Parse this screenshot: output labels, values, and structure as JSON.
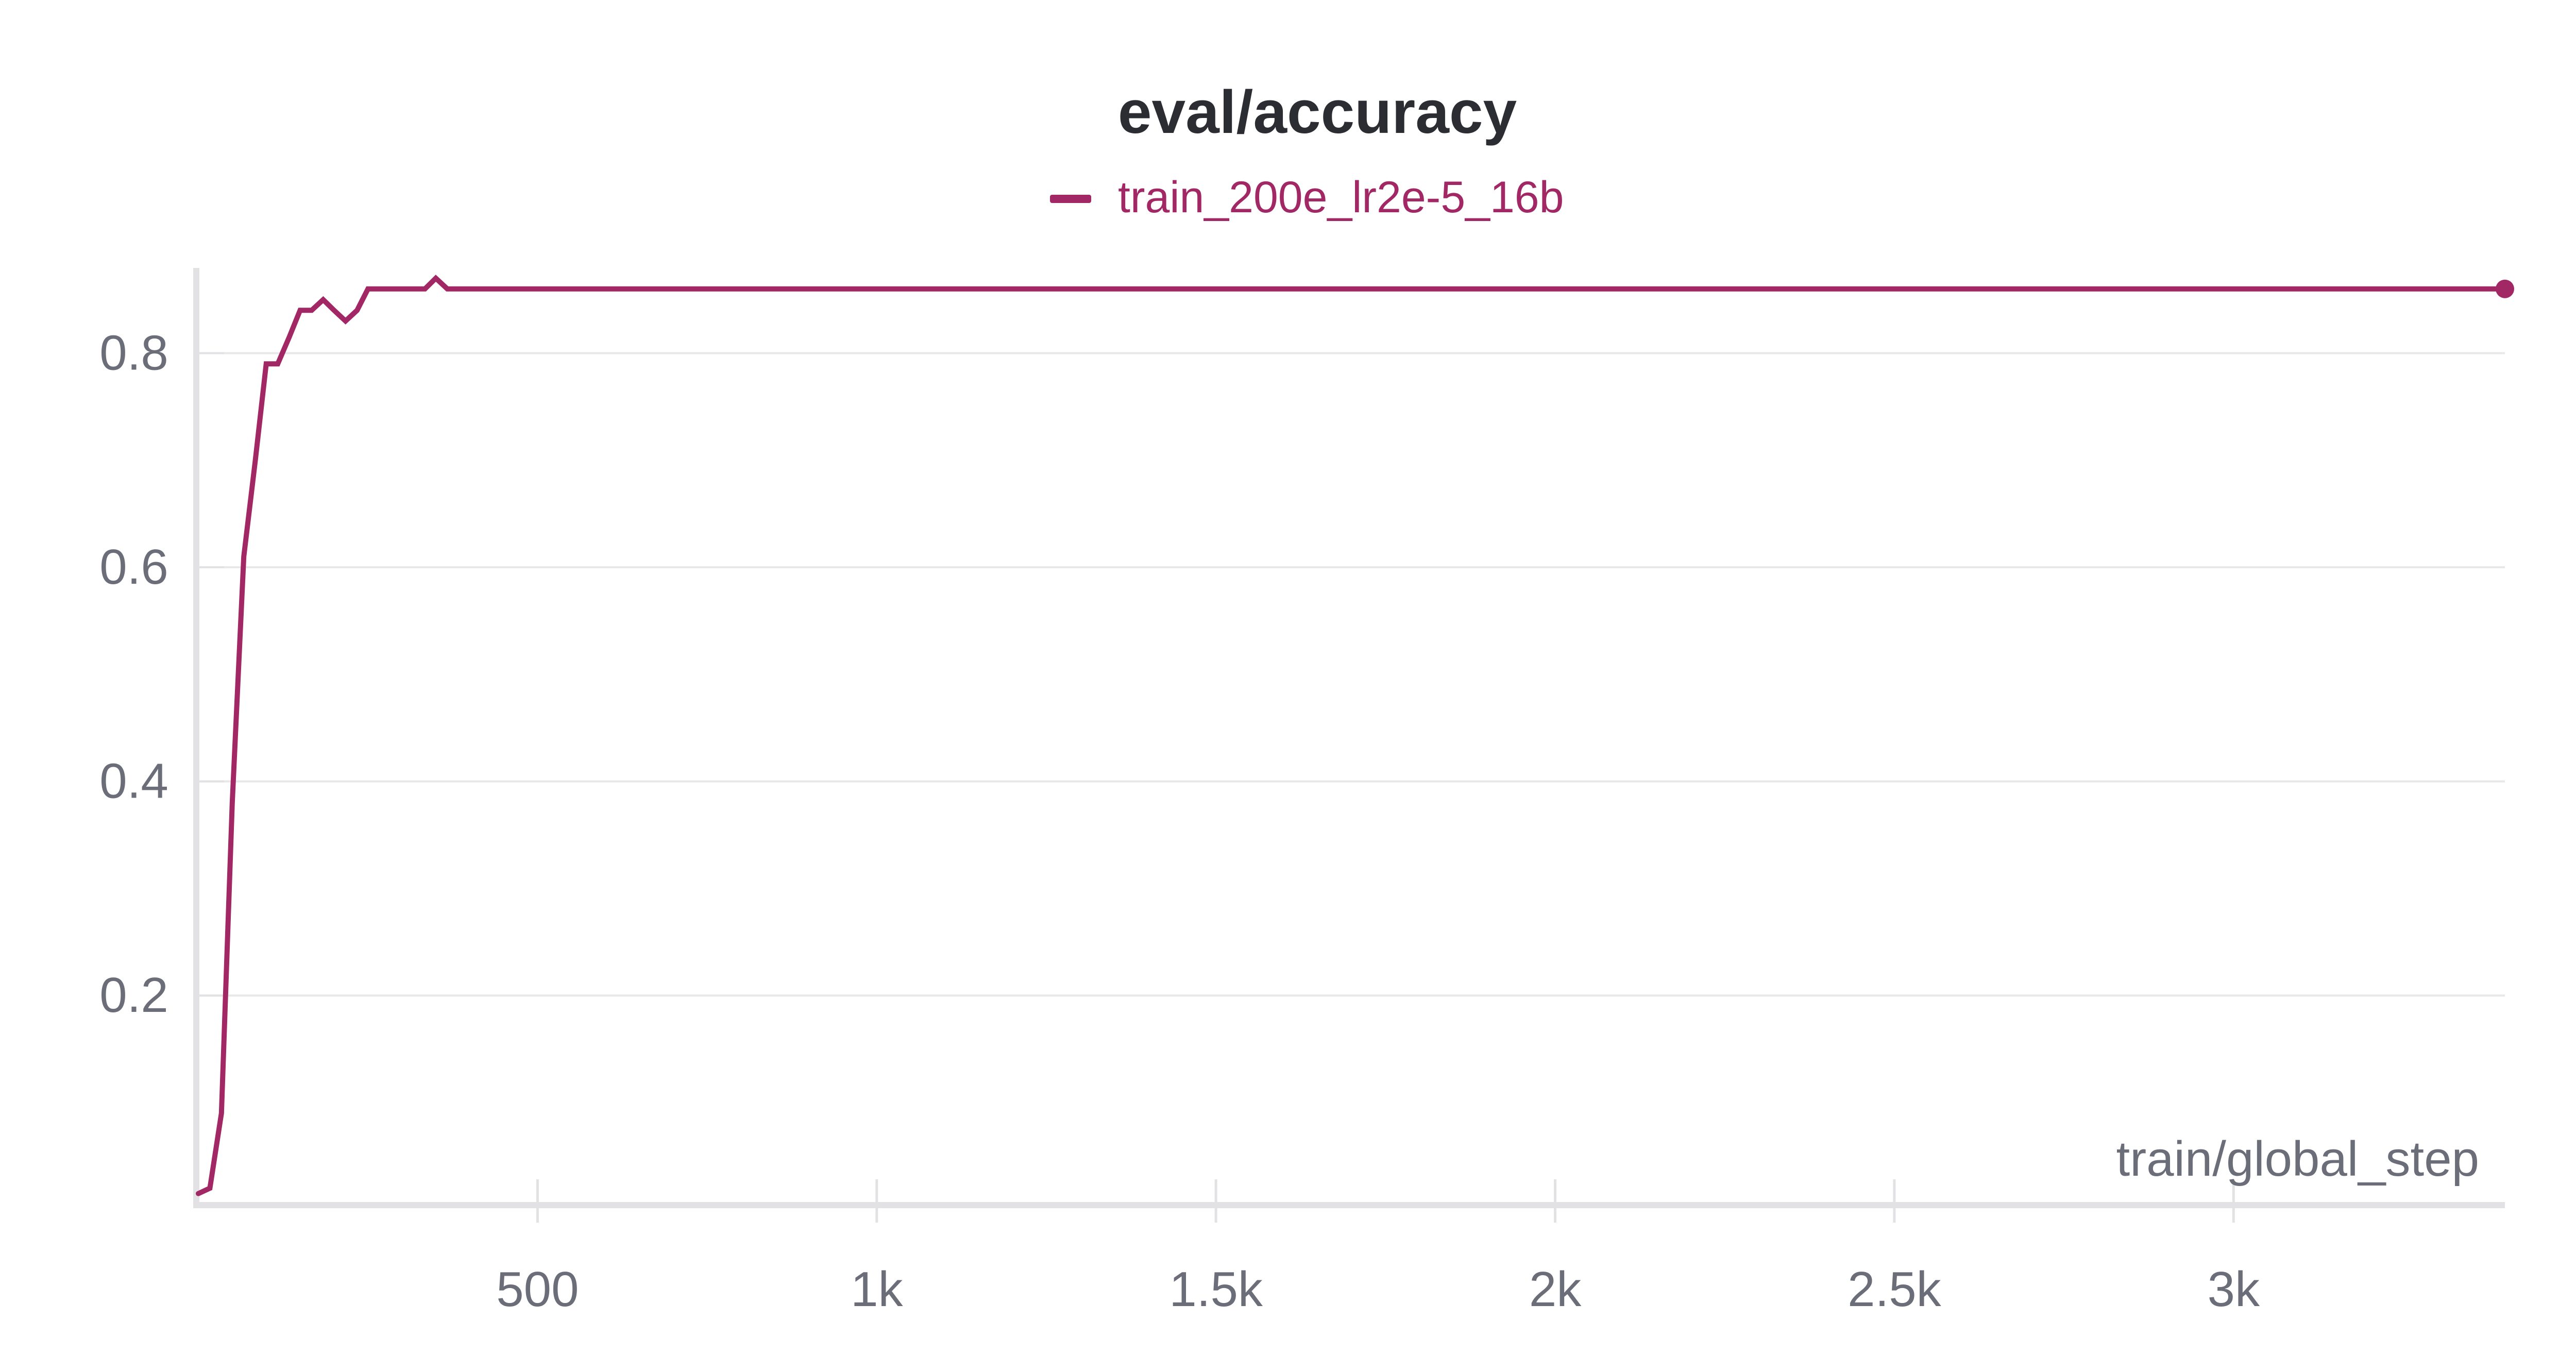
{
  "colors": {
    "series": "#a12864",
    "title": "#2b2d33",
    "axis_text": "#6b6e78",
    "grid": "#e8e8ea",
    "axis_line": "#e2e2e4"
  },
  "chart_data": {
    "type": "line",
    "title": "eval/accuracy",
    "xlabel": "train/global_step",
    "ylabel": "",
    "xlim": [
      0,
      3400
    ],
    "ylim": [
      0.01,
      0.87
    ],
    "x_ticks": [
      500,
      1000,
      1500,
      2000,
      2500,
      3000
    ],
    "x_tick_labels": [
      "500",
      "1k",
      "1.5k",
      "2k",
      "2.5k",
      "3k"
    ],
    "y_ticks": [
      0.2,
      0.4,
      0.6,
      0.8
    ],
    "y_tick_labels": [
      "0.2",
      "0.4",
      "0.6",
      "0.8"
    ],
    "grid": true,
    "legend_position": "top-center",
    "series": [
      {
        "name": "train_200e_lr2e-5_16b",
        "color": "#a12864",
        "x": [
          0,
          17,
          34,
          50,
          67,
          84,
          100,
          117,
          134,
          150,
          167,
          184,
          200,
          217,
          234,
          250,
          267,
          284,
          300,
          317,
          334,
          350,
          367,
          3400
        ],
        "y": [
          0.015,
          0.02,
          0.09,
          0.38,
          0.61,
          0.7,
          0.79,
          0.79,
          0.815,
          0.84,
          0.84,
          0.85,
          0.84,
          0.83,
          0.84,
          0.86,
          0.86,
          0.86,
          0.86,
          0.86,
          0.86,
          0.87,
          0.86,
          0.86
        ]
      }
    ]
  }
}
